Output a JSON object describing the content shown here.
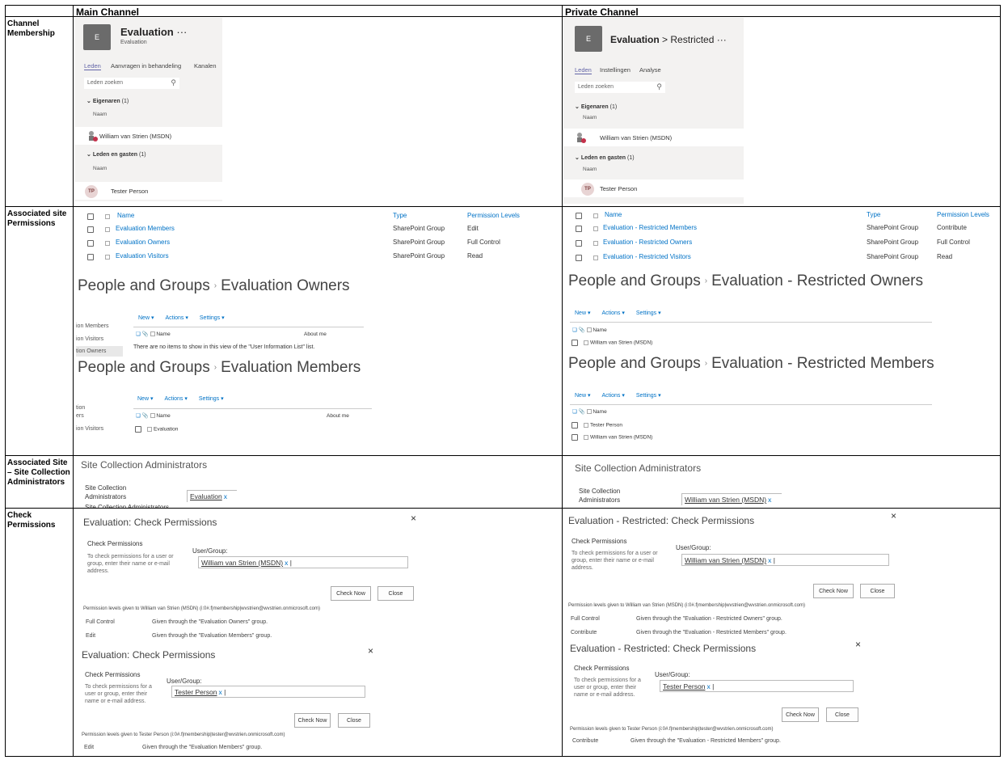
{
  "headers": {
    "main": "Main Channel",
    "private": "Private Channel"
  },
  "rows": {
    "channel_membership": "Channel Membership",
    "associated_site_permissions": "Associated site Permissions",
    "site_collection_admins": "Associated Site – Site Collection Administrators",
    "check_permissions": "Check Permissions"
  },
  "teams_main": {
    "avatar": "E",
    "title": "Evaluation",
    "dots": "···",
    "subtitle": "Evaluation",
    "tabs": [
      "Leden",
      "Aanvragen in behandeling",
      "Kanalen"
    ],
    "search_placeholder": "Leden zoeken",
    "owners": "Eigenaren",
    "owners_count": "(1)",
    "naam": "Naam",
    "owner_name": "William van Strien (MSDN)",
    "members": "Leden en gasten",
    "members_count": "(1)",
    "member_initials": "TP",
    "member_name": "Tester Person"
  },
  "teams_private": {
    "avatar": "E",
    "title": "Evaluation",
    "chevron": ">",
    "subtitle": "Restricted",
    "dots": "···",
    "tabs": [
      "Leden",
      "Instellingen",
      "Analyse"
    ],
    "search_placeholder": "Leden zoeken",
    "owners": "Eigenaren",
    "owners_count": "(1)",
    "naam": "Naam",
    "owner_name": "William van Strien (MSDN)",
    "members": "Leden en gasten",
    "members_count": "(1)",
    "member_initials": "TP",
    "member_name": "Tester Person"
  },
  "perm_table_headers": {
    "name": "Name",
    "type": "Type",
    "levels": "Permission Levels"
  },
  "perm_main": [
    {
      "name": "Evaluation Members",
      "type": "SharePoint Group",
      "level": "Edit"
    },
    {
      "name": "Evaluation Owners",
      "type": "SharePoint Group",
      "level": "Full Control"
    },
    {
      "name": "Evaluation Visitors",
      "type": "SharePoint Group",
      "level": "Read"
    }
  ],
  "perm_private": [
    {
      "name": "Evaluation - Restricted Members",
      "type": "SharePoint Group",
      "level": "Contribute"
    },
    {
      "name": "Evaluation - Restricted Owners",
      "type": "SharePoint Group",
      "level": "Full Control"
    },
    {
      "name": "Evaluation - Restricted Visitors",
      "type": "SharePoint Group",
      "level": "Read"
    }
  ],
  "pg": {
    "prefix": "People and Groups",
    "main_owners": "Evaluation Owners",
    "main_members": "Evaluation Members",
    "priv_owners": "Evaluation - Restricted Owners",
    "priv_members": "Evaluation - Restricted Members",
    "toolbar": {
      "new": "New ▾",
      "actions": "Actions ▾",
      "settings": "Settings ▾"
    },
    "col_name": "Name",
    "col_about": "About me",
    "empty_msg": "There are no items to show in this view of the \"User Information List\" list.",
    "nav1": [
      "ion Members",
      "ion Visitors",
      "tion Owners"
    ],
    "nav2": [
      "tion",
      "ers",
      "ion Visitors"
    ],
    "main_member_row": "Evaluation",
    "priv_owner_row": "William van Strien (MSDN)",
    "priv_member_rows": [
      "Tester Person",
      "William van Strien (MSDN)"
    ]
  },
  "sca": {
    "title": "Site Collection Administrators",
    "label": "Site Collection Administrators",
    "label_cut": "Site Collection Administrators",
    "main_value": "Evaluation",
    "priv_value": "William van Strien (MSDN)",
    "remove": "x"
  },
  "cp": {
    "section": "Check Permissions",
    "help_main1": "To check permissions for a user or group, enter their name or e-mail address.",
    "help_main2": "To check permissions for a user or group, enter their name or e-mail address.",
    "user_group": "User/Group:",
    "check_now": "Check Now",
    "close": "Close",
    "close_x": "×",
    "main": {
      "title": "Evaluation: Check Permissions",
      "user1": "William van Strien (MSDN)",
      "given1": "Permission levels given to William van Strien (MSDN) (i:0#.f|membership|wvstrien@wvstrien.onmicrosoft.com)",
      "r1": [
        {
          "level": "Full Control",
          "via": "Given through the \"Evaluation Owners\" group."
        },
        {
          "level": "Edit",
          "via": "Given through the \"Evaluation Members\" group."
        }
      ],
      "user2": "Tester Person",
      "given2": "Permission levels given to Tester Person (i:0#.f|membership|tester@wvstrien.onmicrosoft.com)",
      "r2": [
        {
          "level": "Edit",
          "via": "Given through the \"Evaluation Members\" group."
        }
      ]
    },
    "priv": {
      "title": "Evaluation - Restricted: Check Permissions",
      "user1": "William van Strien (MSDN)",
      "given1": "Permission levels given to William van Strien (MSDN) (i:0#.f|membership|wvstrien@wvstrien.onmicrosoft.com)",
      "r1": [
        {
          "level": "Full Control",
          "via": "Given through the \"Evaluation - Restricted Owners\" group."
        },
        {
          "level": "Contribute",
          "via": "Given through the \"Evaluation - Restricted Members\" group."
        }
      ],
      "user2": "Tester Person",
      "given2": "Permission levels given to Tester Person (i:0#.f|membership|tester@wvstrien.onmicrosoft.com)",
      "r2": [
        {
          "level": "Contribute",
          "via": "Given through the \"Evaluation - Restricted Members\" group."
        }
      ]
    }
  }
}
